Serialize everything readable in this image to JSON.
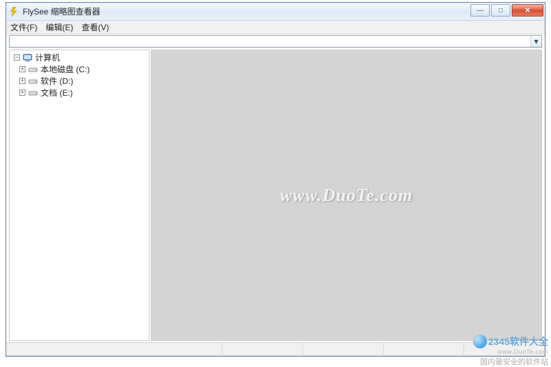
{
  "title": "FlySee 缩略图查看器",
  "menu": {
    "file": "文件(F)",
    "edit": "编辑(E)",
    "view": "查看(V)"
  },
  "tree": {
    "root_expander": "−",
    "root": "计算机",
    "child_expander": "+",
    "items": [
      {
        "label": "本地磁盘 (C:)",
        "icon": "drive"
      },
      {
        "label": "软件 (D:)",
        "icon": "drive"
      },
      {
        "label": "文档 (E:)",
        "icon": "drive"
      }
    ]
  },
  "viewer_watermark": "www.DuoTe.com",
  "combo_arrow": "▾",
  "ext_watermark": {
    "brand": "2345软件大全",
    "url": "www.DuoTe.com",
    "tagline": "国内最安全的软件站"
  },
  "window_controls": {
    "min": "—",
    "max": "□",
    "close": "✕"
  }
}
